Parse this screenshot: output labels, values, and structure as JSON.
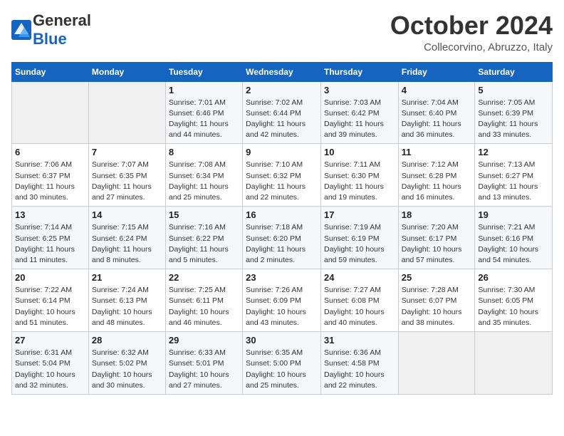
{
  "logo": {
    "general": "General",
    "blue": "Blue"
  },
  "title": "October 2024",
  "location": "Collecorvino, Abruzzo, Italy",
  "weekdays": [
    "Sunday",
    "Monday",
    "Tuesday",
    "Wednesday",
    "Thursday",
    "Friday",
    "Saturday"
  ],
  "weeks": [
    [
      {
        "day": "",
        "info": ""
      },
      {
        "day": "",
        "info": ""
      },
      {
        "day": "1",
        "info": "Sunrise: 7:01 AM\nSunset: 6:46 PM\nDaylight: 11 hours\nand 44 minutes."
      },
      {
        "day": "2",
        "info": "Sunrise: 7:02 AM\nSunset: 6:44 PM\nDaylight: 11 hours\nand 42 minutes."
      },
      {
        "day": "3",
        "info": "Sunrise: 7:03 AM\nSunset: 6:42 PM\nDaylight: 11 hours\nand 39 minutes."
      },
      {
        "day": "4",
        "info": "Sunrise: 7:04 AM\nSunset: 6:40 PM\nDaylight: 11 hours\nand 36 minutes."
      },
      {
        "day": "5",
        "info": "Sunrise: 7:05 AM\nSunset: 6:39 PM\nDaylight: 11 hours\nand 33 minutes."
      }
    ],
    [
      {
        "day": "6",
        "info": "Sunrise: 7:06 AM\nSunset: 6:37 PM\nDaylight: 11 hours\nand 30 minutes."
      },
      {
        "day": "7",
        "info": "Sunrise: 7:07 AM\nSunset: 6:35 PM\nDaylight: 11 hours\nand 27 minutes."
      },
      {
        "day": "8",
        "info": "Sunrise: 7:08 AM\nSunset: 6:34 PM\nDaylight: 11 hours\nand 25 minutes."
      },
      {
        "day": "9",
        "info": "Sunrise: 7:10 AM\nSunset: 6:32 PM\nDaylight: 11 hours\nand 22 minutes."
      },
      {
        "day": "10",
        "info": "Sunrise: 7:11 AM\nSunset: 6:30 PM\nDaylight: 11 hours\nand 19 minutes."
      },
      {
        "day": "11",
        "info": "Sunrise: 7:12 AM\nSunset: 6:28 PM\nDaylight: 11 hours\nand 16 minutes."
      },
      {
        "day": "12",
        "info": "Sunrise: 7:13 AM\nSunset: 6:27 PM\nDaylight: 11 hours\nand 13 minutes."
      }
    ],
    [
      {
        "day": "13",
        "info": "Sunrise: 7:14 AM\nSunset: 6:25 PM\nDaylight: 11 hours\nand 11 minutes."
      },
      {
        "day": "14",
        "info": "Sunrise: 7:15 AM\nSunset: 6:24 PM\nDaylight: 11 hours\nand 8 minutes."
      },
      {
        "day": "15",
        "info": "Sunrise: 7:16 AM\nSunset: 6:22 PM\nDaylight: 11 hours\nand 5 minutes."
      },
      {
        "day": "16",
        "info": "Sunrise: 7:18 AM\nSunset: 6:20 PM\nDaylight: 11 hours\nand 2 minutes."
      },
      {
        "day": "17",
        "info": "Sunrise: 7:19 AM\nSunset: 6:19 PM\nDaylight: 10 hours\nand 59 minutes."
      },
      {
        "day": "18",
        "info": "Sunrise: 7:20 AM\nSunset: 6:17 PM\nDaylight: 10 hours\nand 57 minutes."
      },
      {
        "day": "19",
        "info": "Sunrise: 7:21 AM\nSunset: 6:16 PM\nDaylight: 10 hours\nand 54 minutes."
      }
    ],
    [
      {
        "day": "20",
        "info": "Sunrise: 7:22 AM\nSunset: 6:14 PM\nDaylight: 10 hours\nand 51 minutes."
      },
      {
        "day": "21",
        "info": "Sunrise: 7:24 AM\nSunset: 6:13 PM\nDaylight: 10 hours\nand 48 minutes."
      },
      {
        "day": "22",
        "info": "Sunrise: 7:25 AM\nSunset: 6:11 PM\nDaylight: 10 hours\nand 46 minutes."
      },
      {
        "day": "23",
        "info": "Sunrise: 7:26 AM\nSunset: 6:09 PM\nDaylight: 10 hours\nand 43 minutes."
      },
      {
        "day": "24",
        "info": "Sunrise: 7:27 AM\nSunset: 6:08 PM\nDaylight: 10 hours\nand 40 minutes."
      },
      {
        "day": "25",
        "info": "Sunrise: 7:28 AM\nSunset: 6:07 PM\nDaylight: 10 hours\nand 38 minutes."
      },
      {
        "day": "26",
        "info": "Sunrise: 7:30 AM\nSunset: 6:05 PM\nDaylight: 10 hours\nand 35 minutes."
      }
    ],
    [
      {
        "day": "27",
        "info": "Sunrise: 6:31 AM\nSunset: 5:04 PM\nDaylight: 10 hours\nand 32 minutes."
      },
      {
        "day": "28",
        "info": "Sunrise: 6:32 AM\nSunset: 5:02 PM\nDaylight: 10 hours\nand 30 minutes."
      },
      {
        "day": "29",
        "info": "Sunrise: 6:33 AM\nSunset: 5:01 PM\nDaylight: 10 hours\nand 27 minutes."
      },
      {
        "day": "30",
        "info": "Sunrise: 6:35 AM\nSunset: 5:00 PM\nDaylight: 10 hours\nand 25 minutes."
      },
      {
        "day": "31",
        "info": "Sunrise: 6:36 AM\nSunset: 4:58 PM\nDaylight: 10 hours\nand 22 minutes."
      },
      {
        "day": "",
        "info": ""
      },
      {
        "day": "",
        "info": ""
      }
    ]
  ]
}
